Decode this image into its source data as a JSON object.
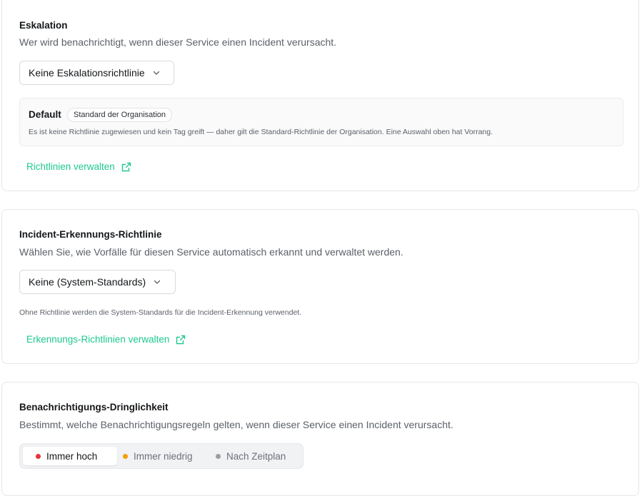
{
  "escalation": {
    "title": "Eskalation",
    "subtitle": "Wer wird benachrichtigt, wenn dieser Service einen Incident verursacht.",
    "select_value": "Keine Eskalationsrichtlinie",
    "default_label": "Default",
    "default_badge": "Standard der Organisation",
    "default_desc": "Es ist keine Richtlinie zugewiesen und kein Tag greift — daher gilt die Standard-Richtlinie der Organisation. Eine Auswahl oben hat Vorrang.",
    "manage_link": "Richtlinien verwalten"
  },
  "detection": {
    "title": "Incident-Erkennungs-Richtlinie",
    "subtitle": "Wählen Sie, wie Vorfälle für diesen Service automatisch erkannt und verwaltet werden.",
    "select_value": "Keine (System-Standards)",
    "helper": "Ohne Richtlinie werden die System-Standards für die Incident-Erkennung verwendet.",
    "manage_link": "Erkennungs-Richtlinien verwalten"
  },
  "urgency": {
    "title": "Benachrichtigungs-Dringlichkeit",
    "subtitle": "Bestimmt, welche Benachrichtigungsregeln gelten, wenn dieser Service einen Incident verursacht.",
    "options": [
      {
        "label": "Immer hoch",
        "color": "#e5343b",
        "selected": true
      },
      {
        "label": "Immer niedrig",
        "color": "#f59e0b",
        "selected": false
      },
      {
        "label": "Nach Zeitplan",
        "color": "#9a9da3",
        "selected": false
      }
    ]
  },
  "colors": {
    "accent": "#1ec98f"
  }
}
